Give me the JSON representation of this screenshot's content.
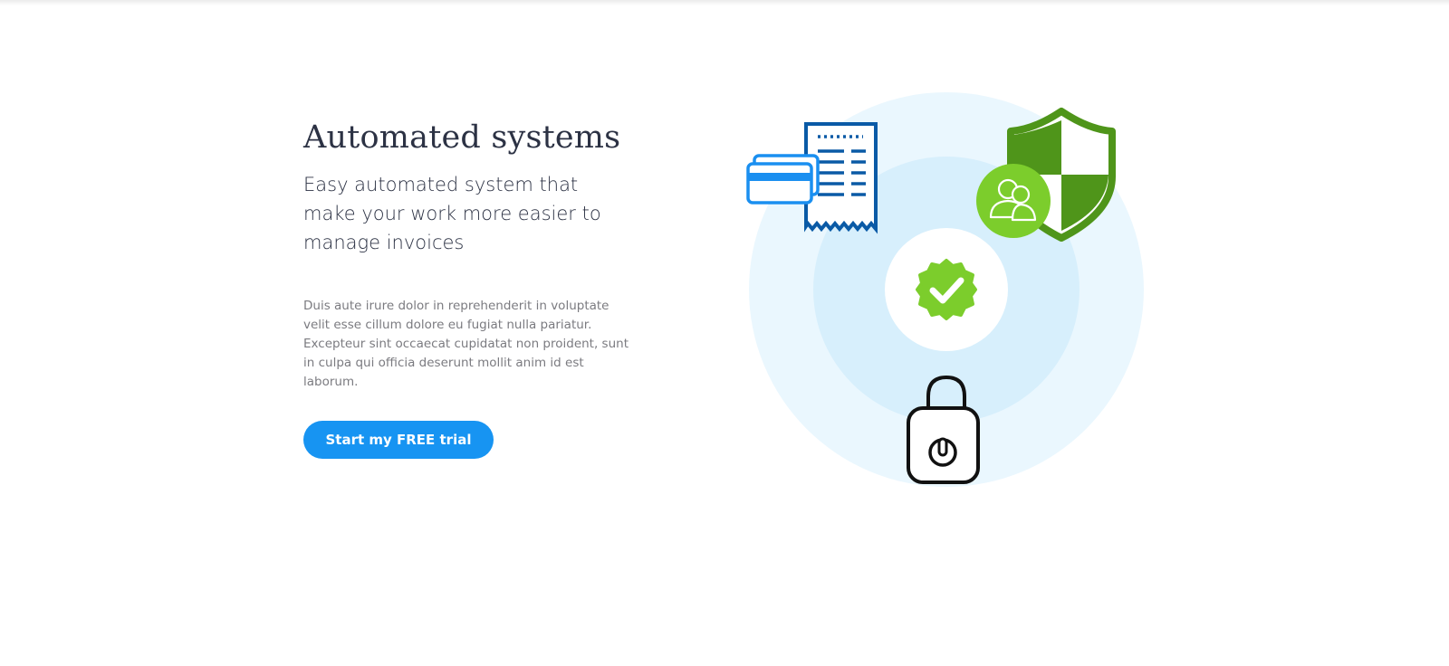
{
  "hero": {
    "title": "Automated systems",
    "subtitle": "Easy automated system that make your work more easier to manage invoices",
    "body": "Duis aute irure dolor in reprehenderit in voluptate velit esse cillum dolore eu fugiat nulla pariatur. Excepteur sint occaecat cupidatat non proident, sunt in culpa qui officia deserunt mollit anim id est laborum.",
    "cta_label": "Start my FREE trial"
  },
  "illustration": {
    "icons": [
      "credit-card-icon",
      "receipt-icon",
      "shield-icon",
      "users-icon",
      "verified-check-icon",
      "padlock-icon"
    ]
  },
  "colors": {
    "accent": "#1794f2",
    "heading": "#2c3244",
    "body_text": "#7b7b80",
    "receipt_blue": "#0a5aa6",
    "card_blue": "#1a8ff0",
    "shield_green": "#4f951a",
    "badge_green": "#7ccd2c",
    "outer_ring": "#eaf7fe",
    "inner_ring": "#d7effc"
  }
}
